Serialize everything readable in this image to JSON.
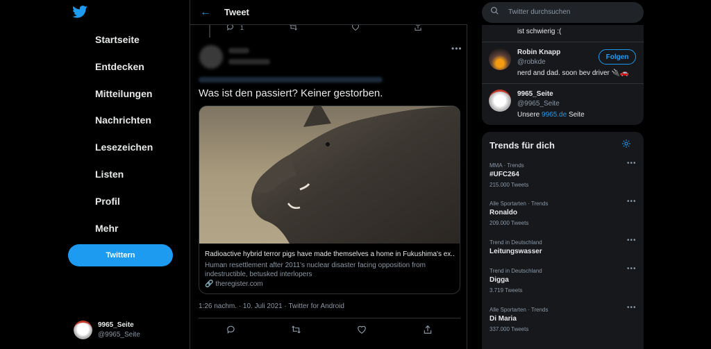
{
  "nav": {
    "items": [
      {
        "label": "Startseite"
      },
      {
        "label": "Entdecken"
      },
      {
        "label": "Mitteilungen"
      },
      {
        "label": "Nachrichten"
      },
      {
        "label": "Lesezeichen"
      },
      {
        "label": "Listen"
      },
      {
        "label": "Profil"
      },
      {
        "label": "Mehr"
      }
    ],
    "tweet_button": "Twittern",
    "account": {
      "name": "9965_Seite",
      "handle": "@9965_Seite"
    }
  },
  "header": {
    "title": "Tweet"
  },
  "previous_tweet": {
    "reply_count": "1"
  },
  "tweet": {
    "text": "Was ist den passiert? Keiner gestorben.",
    "card": {
      "title": "Radioactive hybrid terror pigs have made themselves a home in Fukushima's ex...",
      "description": "Human resettlement after 2011's nuclear disaster facing opposition from indestructible, betusked interlopers",
      "domain": "theregister.com"
    },
    "meta": "1:26 nachm. · 10. Juli 2021 · Twitter for Android"
  },
  "search": {
    "placeholder": "Twitter durchsuchen"
  },
  "who_to_follow": {
    "partial_bio": "ist schwierig :(",
    "users": [
      {
        "name": "Robin Knapp",
        "handle": "@robkde",
        "bio": "nerd and dad. soon bev driver 🔌🚗",
        "button": "Folgen"
      },
      {
        "name": "9965_Seite",
        "handle": "@9965_Seite",
        "bio_prefix": "Unsere ",
        "bio_link": "9965.de",
        "bio_suffix": " Seite"
      }
    ]
  },
  "trends": {
    "title": "Trends für dich",
    "items": [
      {
        "context": "MMA · Trends",
        "name": "#UFC264",
        "count": "215.000 Tweets"
      },
      {
        "context": "Alle Sportarten · Trends",
        "name": "Ronaldo",
        "count": "209.000 Tweets"
      },
      {
        "context": "Trend in Deutschland",
        "name": "Leitungswasser",
        "count": ""
      },
      {
        "context": "Trend in Deutschland",
        "name": "Digga",
        "count": "3.719 Tweets"
      },
      {
        "context": "Alle Sportarten · Trends",
        "name": "Di Maria",
        "count": "337.000 Tweets"
      }
    ]
  },
  "colors": {
    "accent": "#1d9bf0",
    "background": "#000000",
    "panel": "#16181c",
    "border": "#2f3336"
  },
  "icons": [
    "twitter-logo-icon",
    "back-arrow-icon",
    "reply-icon",
    "retweet-icon",
    "like-icon",
    "share-icon",
    "more-icon",
    "search-icon",
    "gear-icon",
    "link-icon"
  ]
}
